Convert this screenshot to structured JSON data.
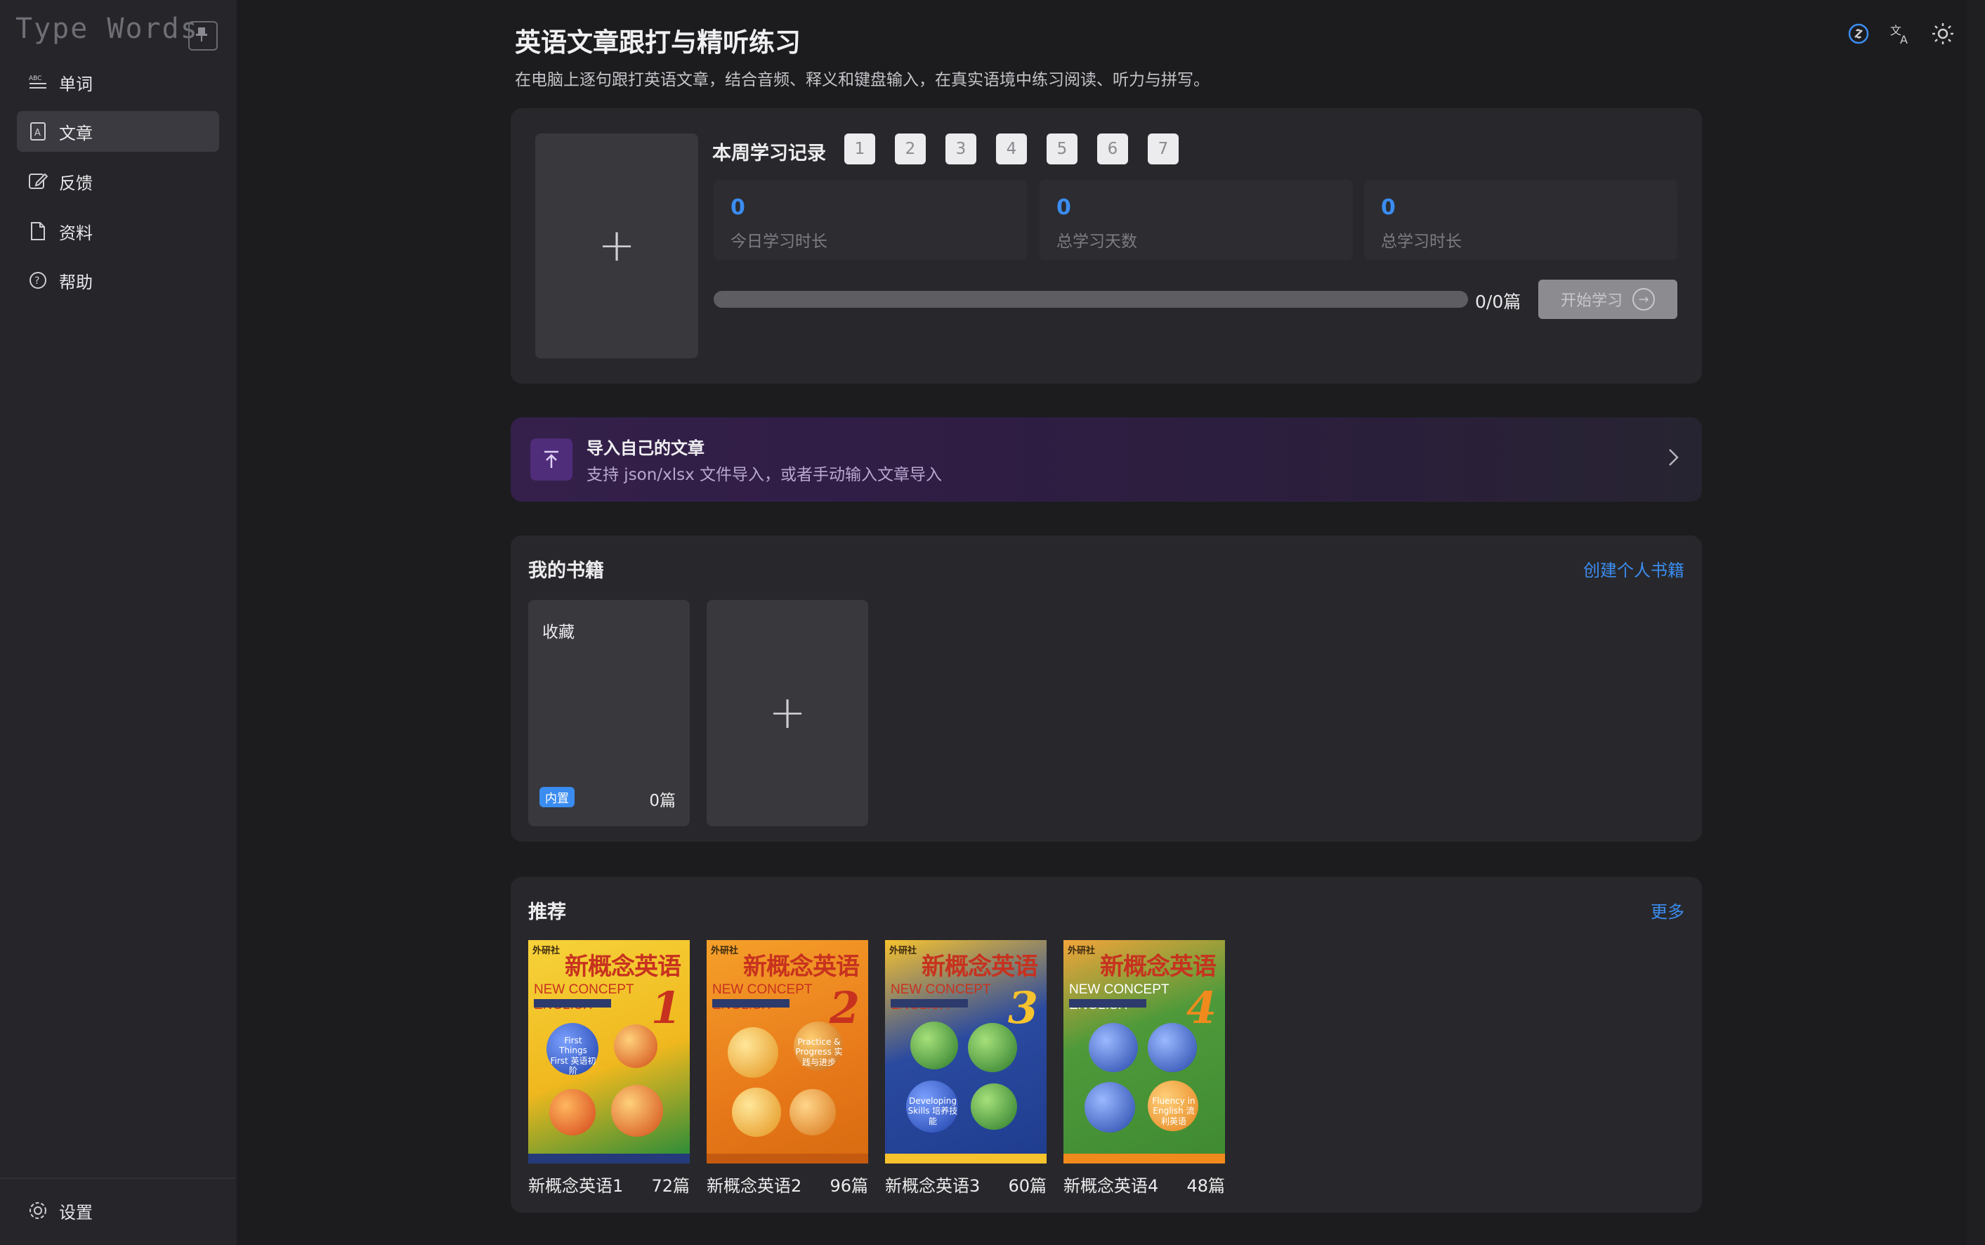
{
  "sidebar": {
    "logo": "Type Words",
    "items": [
      {
        "label": "单词",
        "icon": "abc-icon"
      },
      {
        "label": "文章",
        "icon": "article-icon"
      },
      {
        "label": "反馈",
        "icon": "feedback-icon"
      },
      {
        "label": "资料",
        "icon": "document-icon"
      },
      {
        "label": "帮助",
        "icon": "help-icon"
      }
    ],
    "settings_label": "设置"
  },
  "topbar": {
    "icons": [
      "link-icon",
      "translate-icon",
      "sun-icon"
    ]
  },
  "header": {
    "title": "英语文章跟打与精听练习",
    "subtitle": "在电脑上逐句跟打英语文章，结合音频、释义和键盘输入，在真实语境中练习阅读、听力与拼写。"
  },
  "weekly": {
    "title": "本周学习记录",
    "days": [
      "1",
      "2",
      "3",
      "4",
      "5",
      "6",
      "7"
    ],
    "stats": [
      {
        "value": "0",
        "label": "今日学习时长"
      },
      {
        "value": "0",
        "label": "总学习天数"
      },
      {
        "value": "0",
        "label": "总学习时长"
      }
    ],
    "progress": 0,
    "progress_text": "0/0篇",
    "start_label": "开始学习"
  },
  "import_banner": {
    "title": "导入自己的文章",
    "desc": "支持 json/xlsx 文件导入，或者手动输入文章导入"
  },
  "my_books": {
    "title": "我的书籍",
    "create_label": "创建个人书籍",
    "items": [
      {
        "name": "收藏",
        "badge": "内置",
        "count": "0篇"
      }
    ]
  },
  "recommend": {
    "title": "推荐",
    "more_label": "更多",
    "books": [
      {
        "name": "新概念英语1",
        "count": "72篇",
        "cover_text": "新概念英语",
        "publisher": "外研社",
        "english": "NEW CONCEPT ENGLISH",
        "num": "1",
        "tag": "First Things First 英语初阶",
        "bg": "#f0c52a"
      },
      {
        "name": "新概念英语2",
        "count": "96篇",
        "cover_text": "新概念英语",
        "publisher": "外研社",
        "english": "NEW CONCEPT ENGLISH",
        "num": "2",
        "tag": "Practice & Progress 实践与进步",
        "bg": "#f08a1c"
      },
      {
        "name": "新概念英语3",
        "count": "60篇",
        "cover_text": "新概念英语",
        "publisher": "外研社",
        "english": "NEW CONCEPT ENGLISH",
        "num": "3",
        "tag": "Developing Skills 培养技能",
        "bg": "#f3b51a"
      },
      {
        "name": "新概念英语4",
        "count": "48篇",
        "cover_text": "新概念英语",
        "publisher": "外研社",
        "english": "NEW CONCEPT ENGLISH",
        "num": "4",
        "tag": "Fluency in English 流利英语",
        "bg": "#4e9a3a"
      }
    ]
  },
  "colors": {
    "accent": "#3b8cf0",
    "bg": "#1c1c1f",
    "card": "#28282c"
  }
}
